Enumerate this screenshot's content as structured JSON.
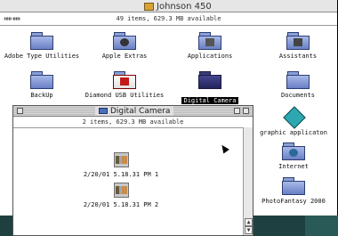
{
  "window": {
    "title": "Johnson 450",
    "view_indicator": "ᚔᚔ",
    "info": "49 items, 629.3 MB available"
  },
  "icons": [
    {
      "label": "Adobe Type Utilities"
    },
    {
      "label": "Apple Extras"
    },
    {
      "label": "Applications"
    },
    {
      "label": "Assistants"
    },
    {
      "label": "BackUp"
    },
    {
      "label": "Diamond USB Utilities"
    },
    {
      "label": "Digital Camera"
    },
    {
      "label": "Documents"
    },
    {
      "label": "graphic applicaton"
    },
    {
      "label": "Internet"
    },
    {
      "label": "PhotoFantasy 2000"
    }
  ],
  "inner_window": {
    "title": "Digital Camera",
    "info": "2 items, 629.3 MB available",
    "photos": [
      {
        "label": "2/20/01 5.18.31 PM 1"
      },
      {
        "label": "2/20/01 5.18.31 PM 2"
      }
    ]
  }
}
